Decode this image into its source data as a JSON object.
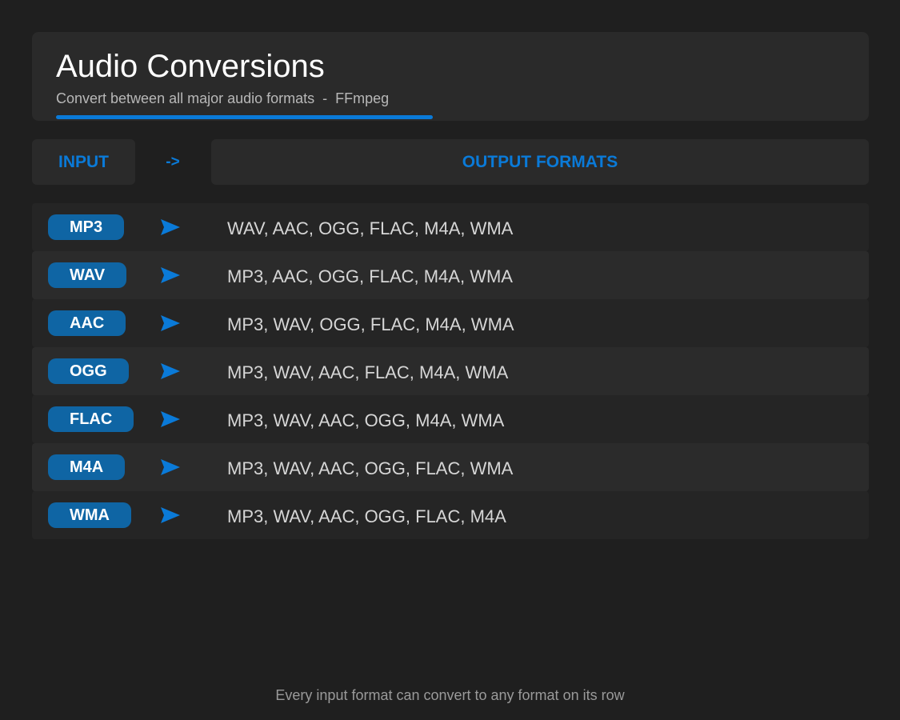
{
  "header": {
    "title": "Audio Conversions",
    "subtitle": "Convert between all major audio formats  -  FFmpeg"
  },
  "columns": {
    "input_label": "INPUT",
    "arrow_label": "->",
    "output_label": "OUTPUT FORMATS"
  },
  "rows": [
    {
      "input": "MP3",
      "outputs": "WAV, AAC, OGG, FLAC, M4A, WMA"
    },
    {
      "input": "WAV",
      "outputs": "MP3, AAC, OGG, FLAC, M4A, WMA"
    },
    {
      "input": "AAC",
      "outputs": "MP3, WAV, OGG, FLAC, M4A, WMA"
    },
    {
      "input": "OGG",
      "outputs": "MP3, WAV, AAC, FLAC, M4A, WMA"
    },
    {
      "input": "FLAC",
      "outputs": "MP3, WAV, AAC, OGG, M4A, WMA"
    },
    {
      "input": "M4A",
      "outputs": "MP3, WAV, AAC, OGG, FLAC, WMA"
    },
    {
      "input": "WMA",
      "outputs": "MP3, WAV, AAC, OGG, FLAC, M4A"
    }
  ],
  "footer": {
    "note": "Every input format can convert to any format on its row"
  },
  "icons": {
    "row_arrow": "play-arrow-icon"
  },
  "colors": {
    "accent": "#0a7ad8",
    "pill_bg": "#0f65a4",
    "background": "#1f1f1f"
  }
}
